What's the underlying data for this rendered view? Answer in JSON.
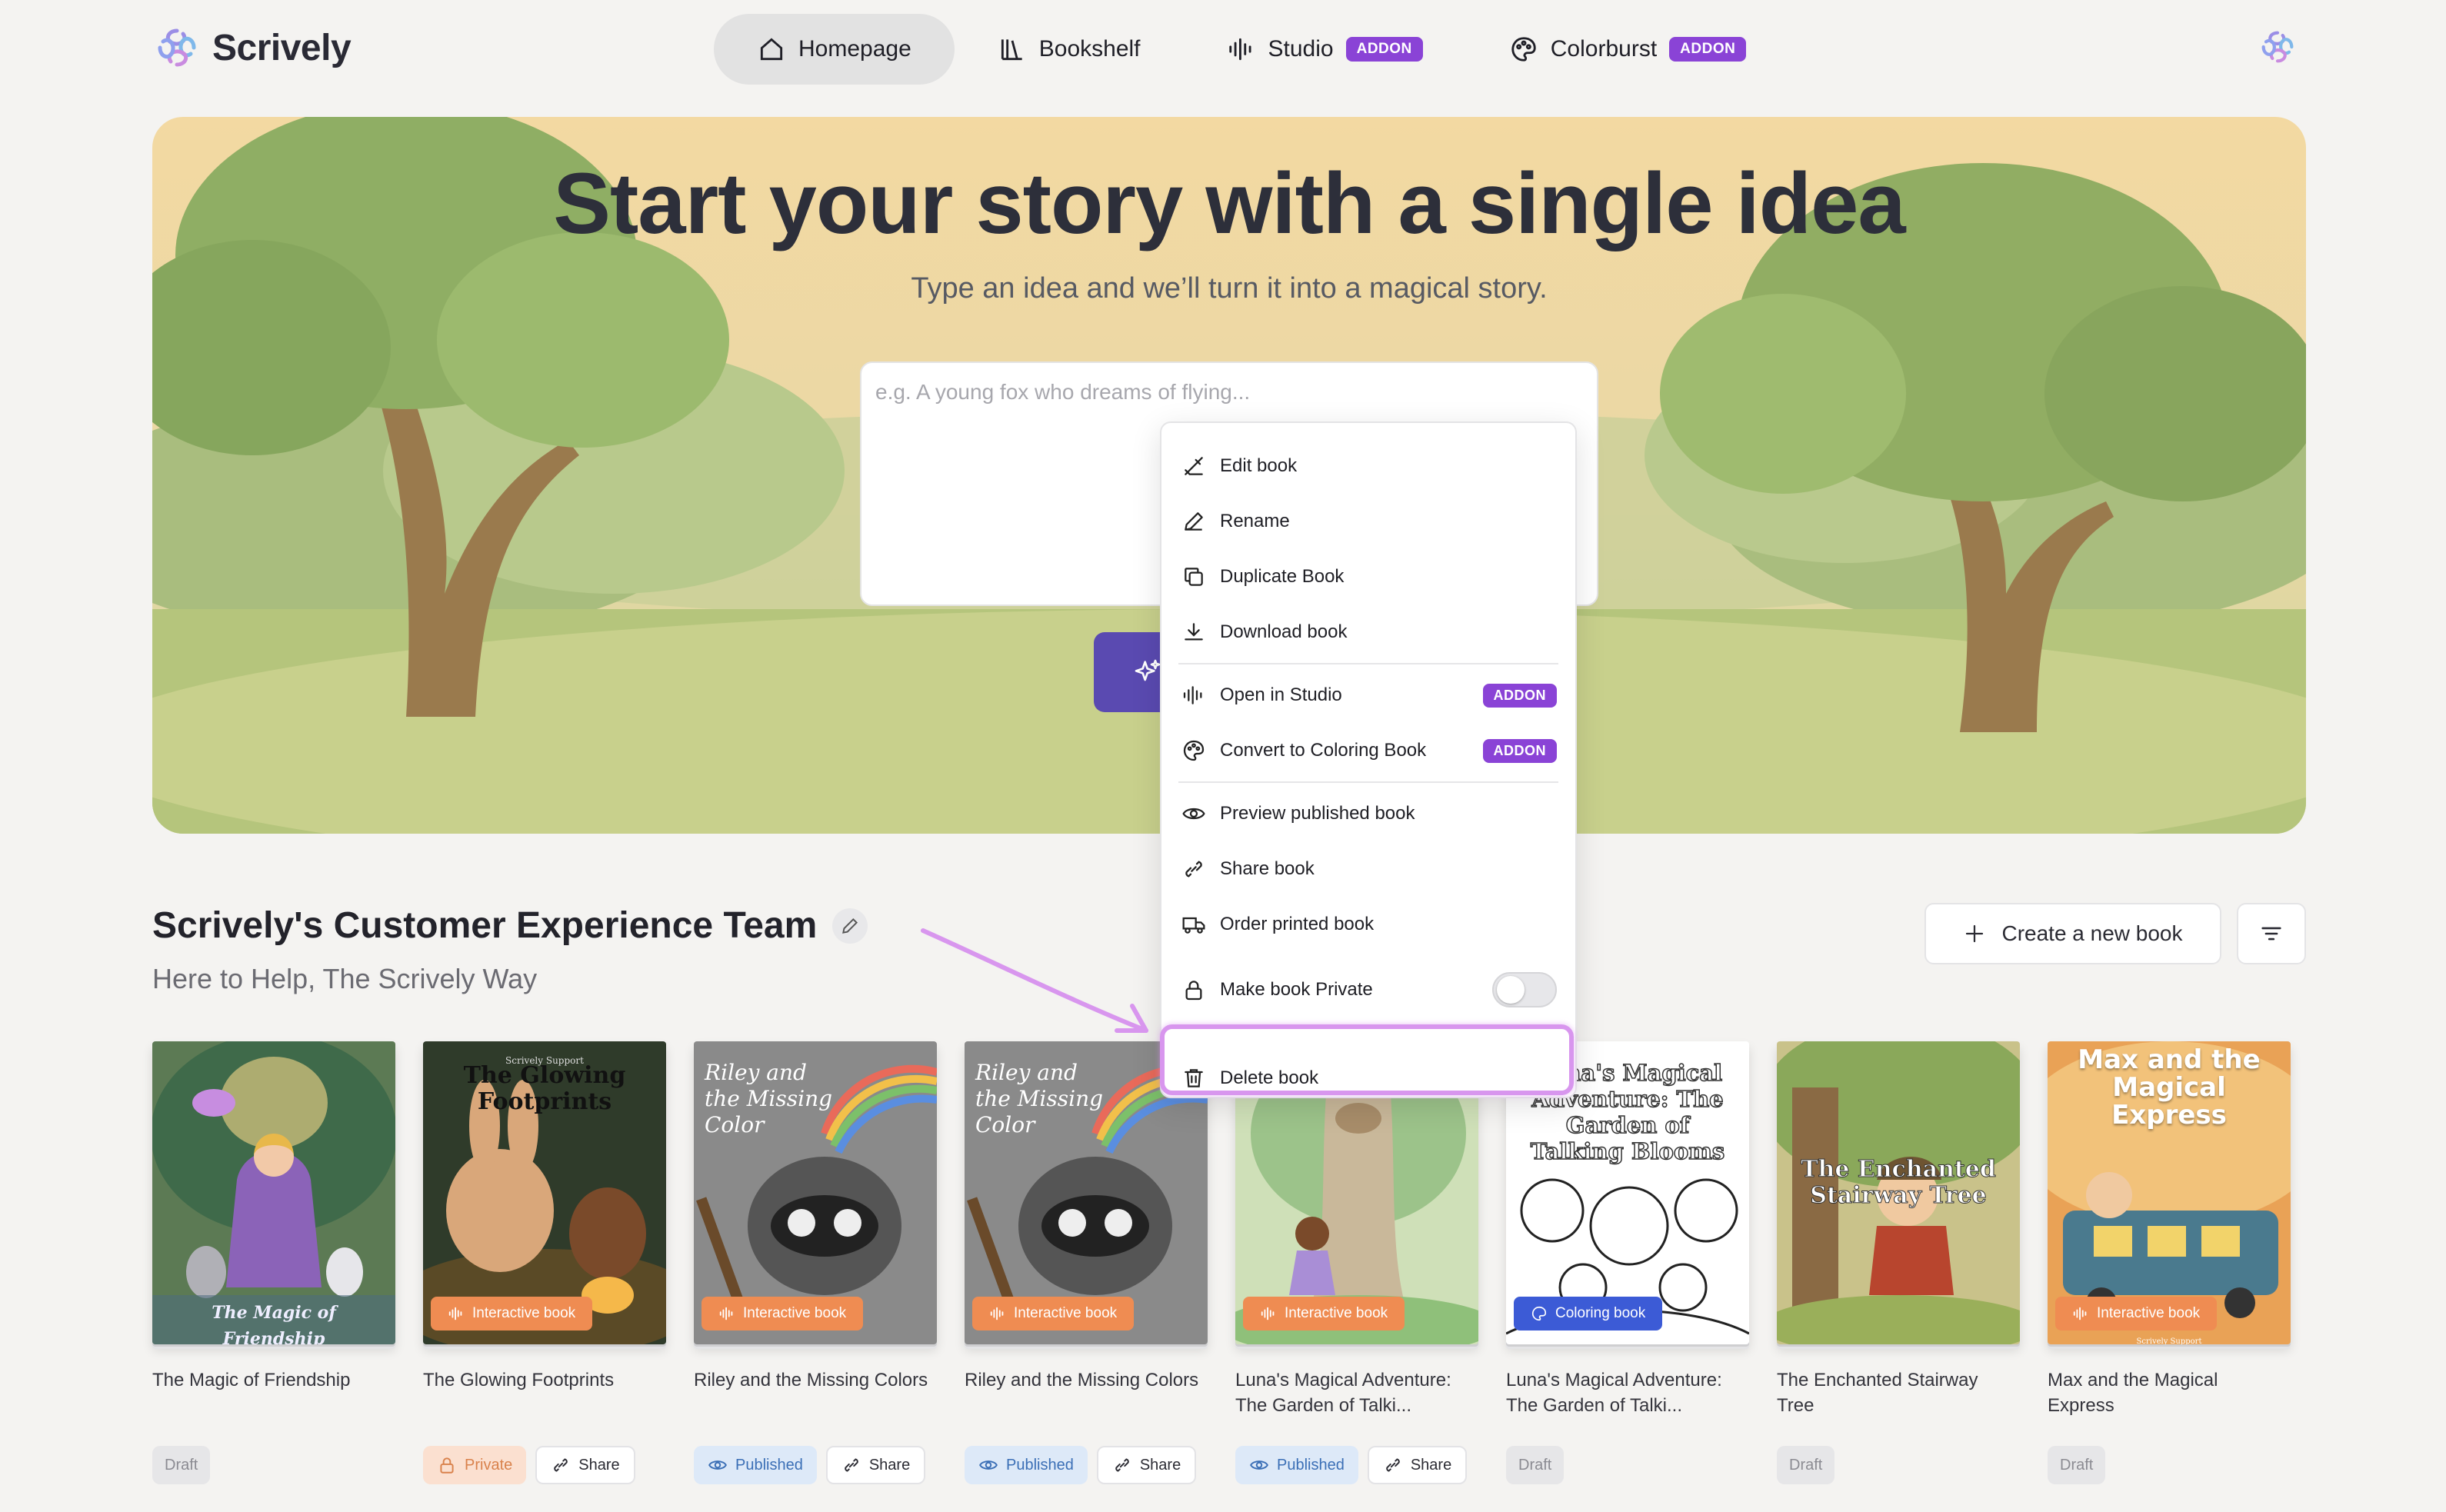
{
  "brand": {
    "name": "Scrively"
  },
  "nav": {
    "tabs": [
      {
        "label": "Homepage",
        "icon": "home-icon",
        "active": true
      },
      {
        "label": "Bookshelf",
        "icon": "books-icon"
      },
      {
        "label": "Studio",
        "icon": "waveform-icon",
        "badge": "ADDON"
      },
      {
        "label": "Colorburst",
        "icon": "palette-icon",
        "badge": "ADDON"
      }
    ]
  },
  "hero": {
    "title": "Start your story with a single idea",
    "subtitle": "Type an idea and we’ll turn it into a magical story.",
    "placeholder": "e.g. A young fox who dreams of flying..."
  },
  "menu": {
    "items": [
      {
        "label": "Edit book",
        "icon": "edit-book-icon"
      },
      {
        "label": "Rename",
        "icon": "pencil-icon"
      },
      {
        "label": "Duplicate Book",
        "icon": "copy-icon"
      },
      {
        "label": "Download book",
        "icon": "download-icon"
      },
      {
        "label": "Open in Studio",
        "icon": "waveform-icon",
        "badge": "ADDON"
      },
      {
        "label": "Convert to Coloring Book",
        "icon": "palette-icon",
        "badge": "ADDON"
      },
      {
        "label": "Preview published book",
        "icon": "eye-icon"
      },
      {
        "label": "Share book",
        "icon": "link-icon"
      },
      {
        "label": "Order printed book",
        "icon": "truck-icon"
      },
      {
        "label": "Make book Private",
        "icon": "lock-icon",
        "toggle": false
      },
      {
        "label": "Delete book",
        "icon": "trash-icon"
      }
    ]
  },
  "section": {
    "title": "Scrively's Customer Experience Team",
    "subtitle": "Here to Help, The Scrively Way",
    "create_label": "Create a new book"
  },
  "books": [
    {
      "title": "The Magic of Friendship",
      "status": "Draft",
      "cover_text": "The Magic of Friendship"
    },
    {
      "title": "The Glowing Footprints",
      "status": "Private",
      "chip": "Interactive book",
      "share": "Share",
      "cover_text": "The Glowing Footprints",
      "cover_small": "Scrively Support"
    },
    {
      "title": "Riley and the Missing Colors",
      "status": "Published",
      "chip": "Interactive book",
      "share": "Share",
      "cover_text": "Riley and the Missing Color"
    },
    {
      "title": "Riley and the Missing Colors",
      "status": "Published",
      "chip": "Interactive book",
      "share": "Share",
      "cover_text": "Riley and the Missing Color"
    },
    {
      "title": "Luna's Magical Adventure: The Garden of Talki...",
      "status": "Published",
      "chip": "Interactive book",
      "share": "Share"
    },
    {
      "title": "Luna's Magical Adventure: The Garden of Talki...",
      "status": "Draft",
      "chip": "Coloring book",
      "cover_text": "Luna's Magical Adventure: The Garden of Talking Blooms"
    },
    {
      "title": "The Enchanted Stairway Tree",
      "status": "Draft",
      "cover_text": "The Enchanted Stairway Tree"
    },
    {
      "title": "Max and the Magical Express",
      "status": "Draft",
      "chip": "Interactive book",
      "cover_text": "Max and the Magical Express",
      "cover_small": "Scrively Support"
    }
  ],
  "colors": {
    "accent": "#8a43d6",
    "button": "#5a4ab1",
    "highlight": "#d896ee"
  }
}
